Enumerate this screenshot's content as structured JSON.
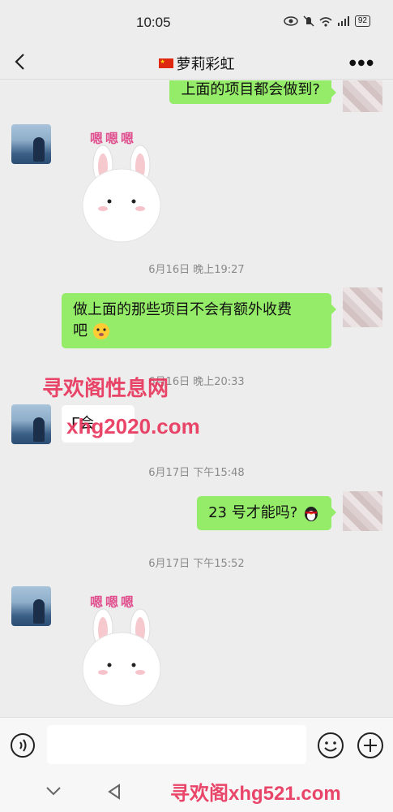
{
  "status_bar": {
    "time": "10:05",
    "battery": "92"
  },
  "header": {
    "title": "萝莉彩虹"
  },
  "messages": {
    "m1": "上面的项目都会做到?",
    "sticker_text": "嗯嗯嗯",
    "ts1": "6月16日 晚上19:27",
    "m2_line1": "做上面的那些项目不会有额外收费",
    "m2_line2": "吧",
    "ts2": "6月16日 晚上20:33",
    "m3": "Γ会",
    "ts3": "6月17日 下午15:48",
    "m4": "23 号才能吗?",
    "ts4": "6月17日 下午15:52"
  },
  "watermarks": {
    "wm1": "寻欢阁性息网",
    "wm2": "xhg2020.com",
    "wm3": "寻欢阁xhg521.com"
  },
  "input": {
    "placeholder": ""
  },
  "icons": {
    "back": "back-arrow-icon",
    "more": "more-icon",
    "voice": "voice-icon",
    "emoji": "emoji-icon",
    "plus": "plus-icon"
  },
  "colors": {
    "outgoing_bubble": "#95ec69",
    "background": "#ededed",
    "incoming_bubble": "#ffffff"
  }
}
